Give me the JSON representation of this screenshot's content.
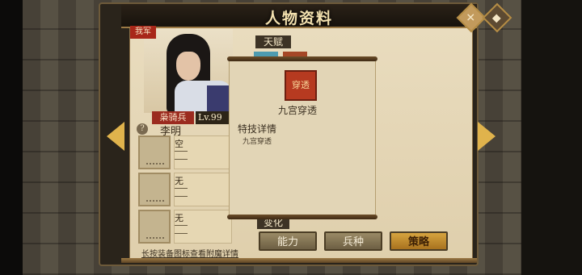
{
  "header": {
    "title": "人物资料"
  },
  "hero": {
    "camp": "我军",
    "unit_type": "枭骑兵",
    "level": "Lv.99",
    "name": "李明"
  },
  "equipment": [
    {
      "name": "空",
      "lines": [
        "---",
        "---"
      ]
    },
    {
      "name": "无",
      "lines": [
        "---",
        "---"
      ]
    },
    {
      "name": "无",
      "lines": [
        "---",
        "---"
      ]
    }
  ],
  "equipment_hint": "长按装备图标查看附魔详情",
  "sections": {
    "talent": "天赋",
    "transform": "变化"
  },
  "tooltip": {
    "icon_text": "穿透",
    "skill_name": "九宫穿透",
    "detail_heading": "特技详情",
    "detail_body": "九宫穿透"
  },
  "tabs": [
    {
      "label": "能力",
      "active": false
    },
    {
      "label": "兵种",
      "active": false
    },
    {
      "label": "策略",
      "active": true
    }
  ],
  "icons": {
    "help": "?",
    "close": "close-icon",
    "settings": "diamond-icon",
    "prev": "left-arrow-icon",
    "next": "right-arrow-icon"
  },
  "colors": {
    "accent_gold": "#e0b34c",
    "camp_red": "#a82719",
    "parchment": "#e9dcbe"
  }
}
